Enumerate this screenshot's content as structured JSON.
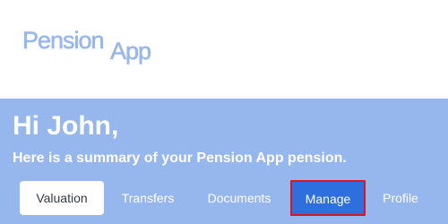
{
  "logo": {
    "part1": "Pension",
    "part2": "App"
  },
  "summary": {
    "greeting": "Hi John,",
    "subtitle": "Here is a summary of your Pension App pension."
  },
  "tabs": [
    {
      "label": "Valuation",
      "state": "selected"
    },
    {
      "label": "Transfers"
    },
    {
      "label": "Documents"
    },
    {
      "label": "Manage",
      "state": "focused"
    },
    {
      "label": "Profile"
    }
  ],
  "colors": {
    "panel": "#96b6ee",
    "logo": "#99b7ee",
    "manage_bg": "#2e6fe0",
    "focus_outline": "#e0141e"
  }
}
